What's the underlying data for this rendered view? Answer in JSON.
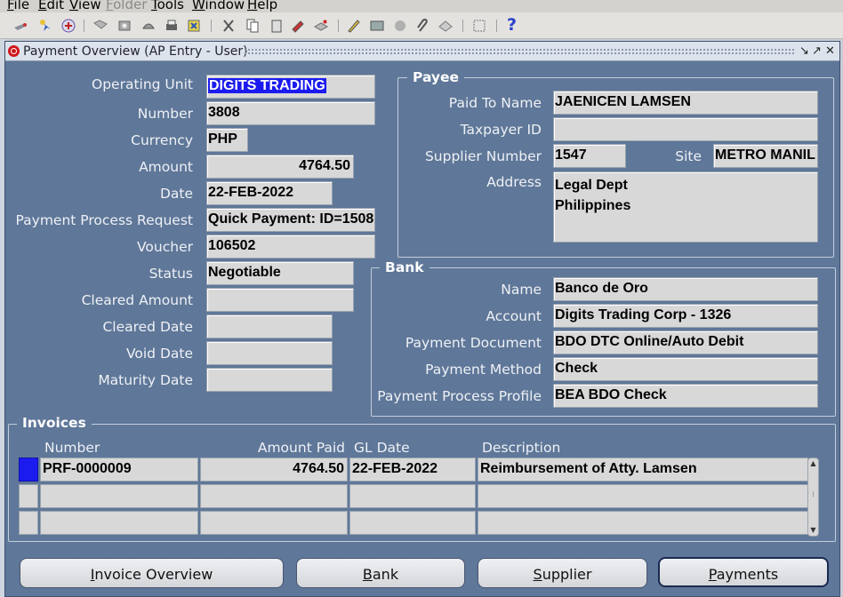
{
  "menubar": {
    "items": [
      {
        "label_ul": "F",
        "label_rest": "ile",
        "disabled": false
      },
      {
        "label_ul": "E",
        "label_rest": "dit",
        "disabled": false
      },
      {
        "label_ul": "V",
        "label_rest": "iew",
        "disabled": false
      },
      {
        "label_ul": "F",
        "label_rest": "older",
        "disabled": true
      },
      {
        "label_ul": "T",
        "label_rest": "ools",
        "disabled": false
      },
      {
        "label_ul": "W",
        "label_rest": "indow",
        "disabled": false
      },
      {
        "label_ul": "H",
        "label_rest": "elp",
        "disabled": false
      }
    ]
  },
  "toolbar": {
    "help_glyph": "?"
  },
  "window": {
    "title": "Payment Overview (AP Entry - User)",
    "controls": [
      "↘",
      "↗",
      "✕"
    ]
  },
  "payment": {
    "operating_unit": {
      "label": "Operating Unit",
      "value": "DIGITS TRADING"
    },
    "number": {
      "label": "Number",
      "value": "3808"
    },
    "currency": {
      "label": "Currency",
      "value": "PHP"
    },
    "amount": {
      "label": "Amount",
      "value": "4764.50"
    },
    "date": {
      "label": "Date",
      "value": "22-FEB-2022"
    },
    "ppr": {
      "label": "Payment Process Request",
      "value": "Quick Payment: ID=1508"
    },
    "voucher": {
      "label": "Voucher",
      "value": "106502"
    },
    "status": {
      "label": "Status",
      "value": "Negotiable"
    },
    "cleared_amount": {
      "label": "Cleared Amount",
      "value": ""
    },
    "cleared_date": {
      "label": "Cleared Date",
      "value": ""
    },
    "void_date": {
      "label": "Void Date",
      "value": ""
    },
    "maturity_date": {
      "label": "Maturity Date",
      "value": ""
    }
  },
  "payee": {
    "title": "Payee",
    "paid_to_name": {
      "label": "Paid To Name",
      "value": "JAENICEN LAMSEN"
    },
    "taxpayer_id": {
      "label": "Taxpayer ID",
      "value": ""
    },
    "supplier_number": {
      "label": "Supplier Number",
      "value": "1547"
    },
    "site": {
      "label": "Site",
      "value": "METRO MANIL"
    },
    "address": {
      "label": "Address",
      "line1": "Legal Dept",
      "line2": "Philippines"
    }
  },
  "bank": {
    "title": "Bank",
    "name": {
      "label": "Name",
      "value": "Banco de Oro"
    },
    "account": {
      "label": "Account",
      "value": "Digits Trading Corp - 1326"
    },
    "payment_document": {
      "label": "Payment Document",
      "value": "BDO DTC Online/Auto Debit"
    },
    "payment_method": {
      "label": "Payment Method",
      "value": "Check"
    },
    "payment_process_profile": {
      "label": "Payment Process Profile",
      "value": "BEA BDO Check"
    }
  },
  "invoices": {
    "title": "Invoices",
    "columns": {
      "number": "Number",
      "amount_paid": "Amount Paid",
      "gl_date": "GL Date",
      "description": "Description"
    },
    "rows": [
      {
        "number": "PRF-0000009",
        "amount_paid": "4764.50",
        "gl_date": "22-FEB-2022",
        "description": "Reimbursement of Atty. Lamsen"
      },
      {
        "number": "",
        "amount_paid": "",
        "gl_date": "",
        "description": ""
      },
      {
        "number": "",
        "amount_paid": "",
        "gl_date": "",
        "description": ""
      }
    ]
  },
  "buttons": {
    "invoice_overview": {
      "ul": "I",
      "rest": "nvoice Overview"
    },
    "bank": {
      "ul": "B",
      "rest": "ank"
    },
    "supplier": {
      "ul": "S",
      "rest": "upplier"
    },
    "payments": {
      "ul": "P",
      "rest": "ayments"
    }
  },
  "colors": {
    "window_bg": "#5f7798",
    "selection": "#1b1bf0",
    "oracle_red": "#d0161b"
  }
}
